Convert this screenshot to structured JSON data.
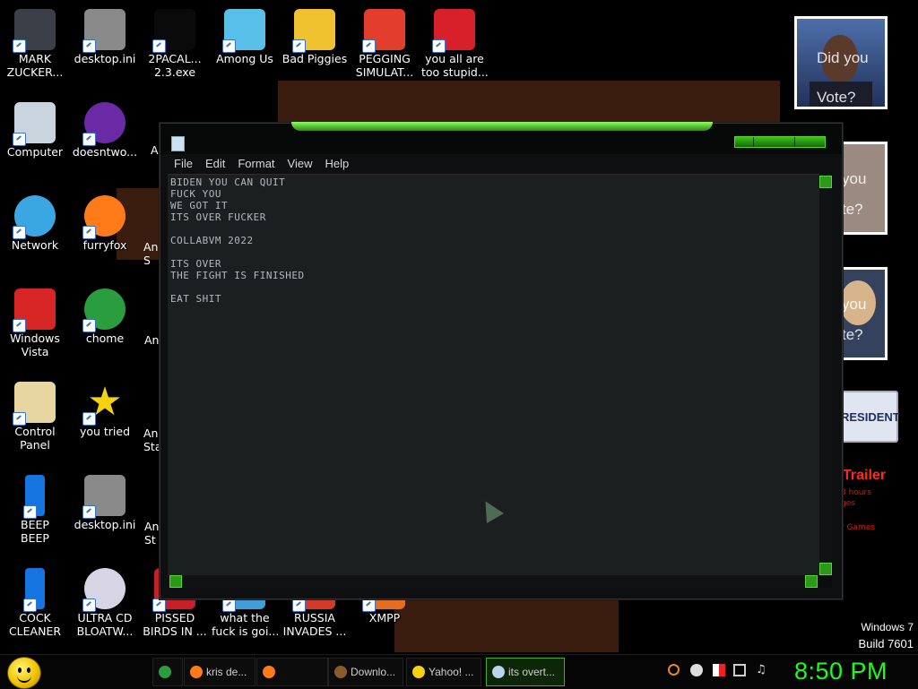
{
  "desktop": {
    "icons": [
      {
        "label": "MARK\nZUCKER...",
        "icon": "mark-zuckerberg-icon",
        "color": "#3a3f48"
      },
      {
        "label": "desktop.ini",
        "icon": "settings-file-icon",
        "color": "#8a8a8a"
      },
      {
        "label": "2PACAL...\n2.3.exe",
        "icon": "console-icon",
        "color": "#0a0a0a"
      },
      {
        "label": "Among Us",
        "icon": "among-us-icon",
        "color": "#58c0e8"
      },
      {
        "label": "Bad Piggies",
        "icon": "bad-piggies-icon",
        "color": "#f1c230"
      },
      {
        "label": "PEGGING\nSIMULAT...",
        "icon": "pegging-sim-icon",
        "color": "#e23d2d"
      },
      {
        "label": "you all are\ntoo stupid...",
        "icon": "dev-cpp-icon",
        "color": "#d8202a"
      },
      {
        "label": "Computer",
        "icon": "computer-icon",
        "color": "#c9d4df"
      },
      {
        "label": "doesntwo...",
        "icon": "yahoo-messenger-icon",
        "color": "#6a2aa5"
      },
      {
        "label": "Network",
        "icon": "network-icon",
        "color": "#3ba7e2"
      },
      {
        "label": "furryfox",
        "icon": "firefox-icon",
        "color": "#ff7a18"
      },
      {
        "label": "Windows\nVista",
        "icon": "recycle-bin-icon",
        "color": "#d82525"
      },
      {
        "label": "chome",
        "icon": "chrome-icon",
        "color": "#2a9d3e"
      },
      {
        "label": "Control\nPanel",
        "icon": "control-panel-icon",
        "color": "#e7d5a2"
      },
      {
        "label": "you tried",
        "icon": "star-icon",
        "color": "#f5d20f"
      },
      {
        "label": "BEEP\nBEEP",
        "icon": "blue-bar-icon",
        "color": "#1674e0"
      },
      {
        "label": "desktop.ini",
        "icon": "settings-file-icon",
        "color": "#8a8a8a"
      },
      {
        "label": "COCK\nCLEANER",
        "icon": "blue-bar-icon",
        "color": "#1674e0"
      },
      {
        "label": "ULTRA CD\nBLOATW...",
        "icon": "cd-icon",
        "color": "#d7d4e4"
      },
      {
        "label": "PISSED\nBIRDS IN ...",
        "icon": "angry-birds-icon",
        "color": "#c8202a"
      },
      {
        "label": "what the\nfuck is goi...",
        "icon": "app-icon",
        "color": "#3fa0d8"
      },
      {
        "label": "RUSSIA\nINVADES ...",
        "icon": "app-icon",
        "color": "#d23a2a"
      },
      {
        "label": "XMPP",
        "icon": "xmpp-icon",
        "color": "#e86c1d"
      }
    ],
    "partial_labels": [
      "A",
      "An\nS",
      "An",
      "An\nSta",
      "An\nSt"
    ],
    "gadgets": {
      "photo_caption_1": "Did you\nVote?",
      "photo_caption_2": "you\nte?",
      "photo_caption_3": "you\nte?",
      "resident_text": "RESIDENT",
      "trailer_text": "Trailer",
      "trailer_sub": "8 hours\nges",
      "trailer_games": "r Games"
    },
    "windows_version": "Windows 7",
    "build": "Build 7601"
  },
  "window": {
    "menu": [
      "File",
      "Edit",
      "Format",
      "View",
      "Help"
    ],
    "text": "BIDEN YOU CAN QUIT\nFUCK YOU\nWE GOT IT\nITS OVER FUCKER\n\nCOLLABVM 2022\n\nITS OVER\nTHE FIGHT IS FINISHED\n\nEAT SHIT"
  },
  "taskbar": {
    "items": [
      {
        "label": "",
        "icon": "chrome-icon",
        "color": "#2a9d3e"
      },
      {
        "label": "kris de...",
        "icon": "firefox-icon",
        "color": "#ff7a18"
      },
      {
        "label": "",
        "icon": "firefox-icon",
        "color": "#ff7a18"
      },
      {
        "label": "Downlo...",
        "icon": "download-icon",
        "color": "#8a5a2b"
      },
      {
        "label": "Yahoo! ...",
        "icon": "yahoo-messenger-icon",
        "color": "#f5d20f"
      },
      {
        "label": "its overt...",
        "icon": "notepad-icon",
        "color": "#bcd4ec"
      }
    ],
    "clock": "8:50 PM",
    "accent": "#19ff19"
  }
}
